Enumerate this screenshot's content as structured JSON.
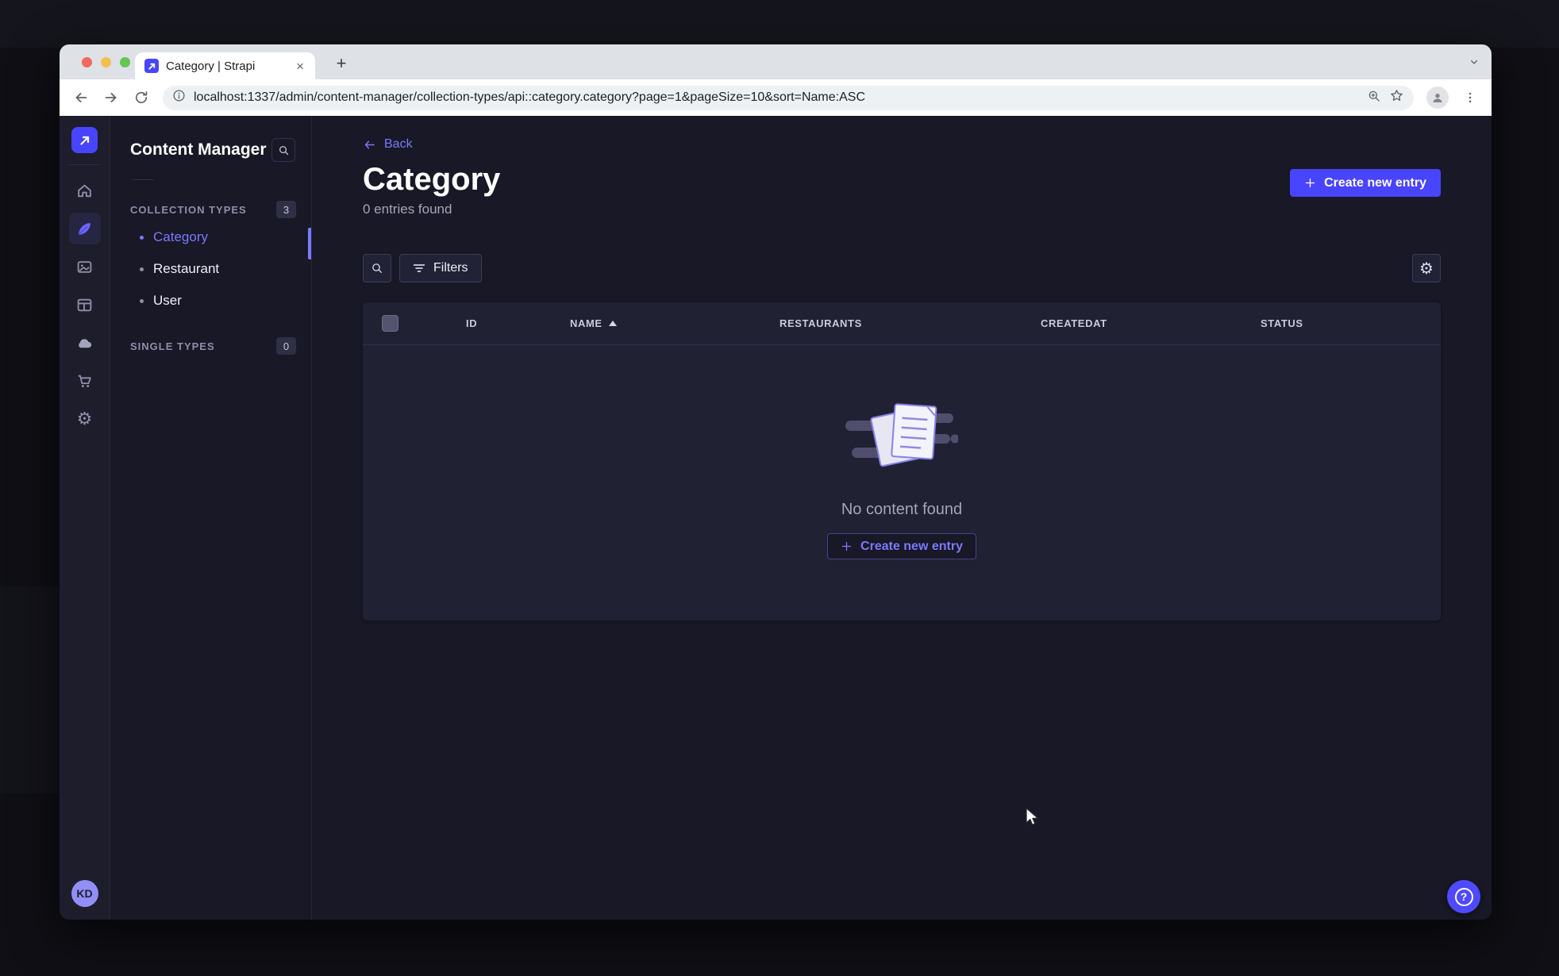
{
  "browser": {
    "tab_title": "Category | Strapi",
    "url": "localhost:1337/admin/content-manager/collection-types/api::category.category?page=1&pageSize=10&sort=Name:ASC",
    "new_tab_glyph": "+",
    "close_tab_glyph": "×"
  },
  "rail": {
    "icons": [
      "strapi-logo",
      "home",
      "content-manager",
      "media-library",
      "content-type-builder",
      "cloud",
      "marketplace",
      "settings"
    ],
    "active_icon": "content-manager",
    "avatar_initials": "KD"
  },
  "subnav": {
    "title": "Content Manager",
    "sections": [
      {
        "label": "COLLECTION TYPES",
        "count": "3"
      },
      {
        "label": "SINGLE TYPES",
        "count": "0"
      }
    ],
    "collection_items": [
      {
        "label": "Category"
      },
      {
        "label": "Restaurant"
      },
      {
        "label": "User"
      }
    ]
  },
  "header": {
    "back_label": "Back",
    "title": "Category",
    "subtitle": "0 entries found",
    "create_button_label": "Create new entry"
  },
  "filter_bar": {
    "filters_label": "Filters"
  },
  "table": {
    "columns": [
      "ID",
      "NAME",
      "RESTAURANTS",
      "CREATEDAT",
      "STATUS"
    ],
    "sorted_column": "NAME",
    "sort_direction": "ASC",
    "empty_state": {
      "message": "No content found",
      "create_button_label": "Create new entry"
    }
  },
  "colors": {
    "primary": "#4945ff",
    "primary_light": "#7b79ff",
    "app_background": "#181826",
    "card_background": "#212134"
  }
}
